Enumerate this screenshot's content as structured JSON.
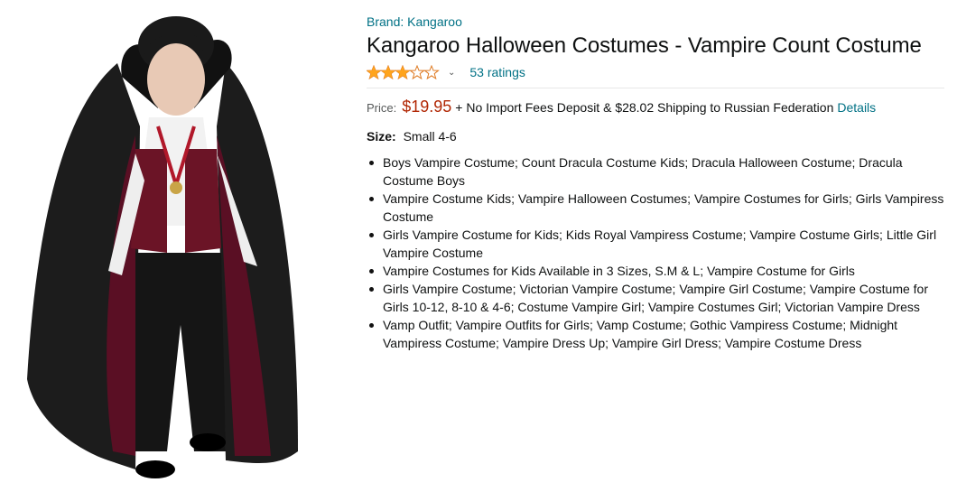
{
  "product": {
    "brand_link": "Brand: Kangaroo",
    "title": "Kangaroo Halloween Costumes - Vampire Count Costume",
    "rating_fraction": 0.6,
    "rating_dropdown_icon": "chevron-down-icon",
    "ratings_count": "53 ratings",
    "price_label": "Price:",
    "price": "$19.95",
    "shipping_text": "+ No Import Fees Deposit & $28.02 Shipping to Russian Federation",
    "details_link": "Details",
    "size_label": "Size:",
    "size_value": "Small 4-6",
    "bullets": [
      "Boys Vampire Costume; Count Dracula Costume Kids; Dracula Halloween Costume; Dracula Costume Boys",
      "Vampire Costume Kids; Vampire Halloween Costumes; Vampire Costumes for Girls; Girls Vampiress Costume",
      "Girls Vampire Costume for Kids; Kids Royal Vampiress Costume; Vampire Costume Girls; Little Girl Vampire Costume",
      "Vampire Costumes for Kids Available in 3 Sizes, S.M & L; Vampire Costume for Girls",
      "Girls Vampire Costume; Victorian Vampire Costume; Vampire Girl Costume; Vampire Costume for Girls 10-12, 8-10 & 4-6; Costume Vampire Girl; Vampire Costumes Girl; Victorian Vampire Dress",
      "Vamp Outfit; Vampire Outfits for Girls; Vamp Costume; Gothic Vampiress Costume; Midnight Vampiress Costume; Vampire Dress Up; Vampire Girl Dress; Vampire Costume Dress"
    ]
  },
  "colors": {
    "link": "#007185",
    "price": "#B12704",
    "star": "#FFA41C"
  }
}
